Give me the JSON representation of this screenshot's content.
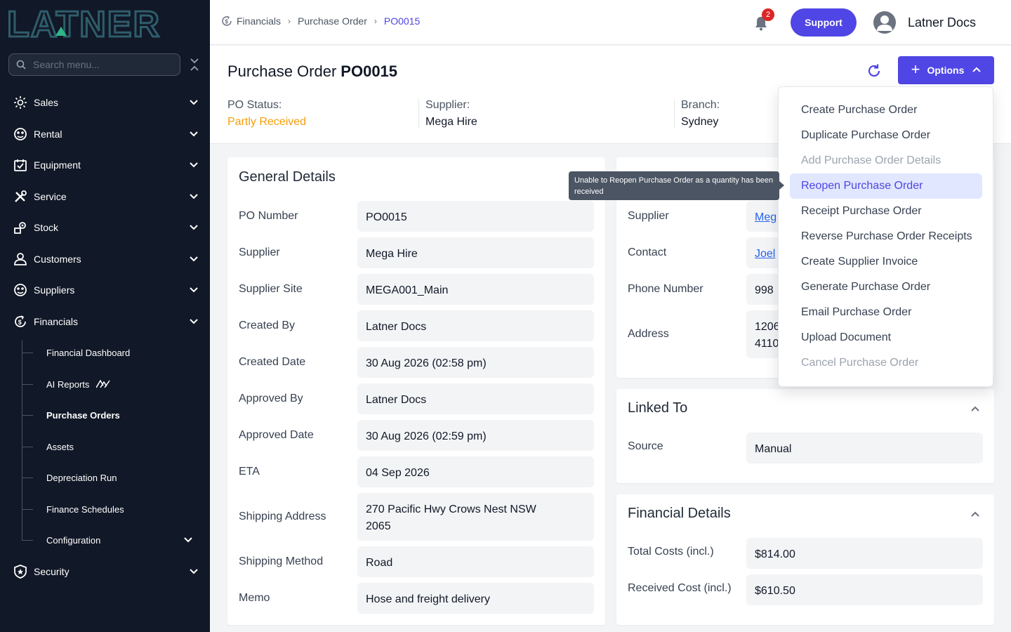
{
  "brand": {
    "logo_text": "LATNER",
    "accent": "#4f46e5",
    "sidebar_bg": "#111827"
  },
  "sidebar": {
    "search_placeholder": "Search menu...",
    "items": [
      {
        "label": "Sales",
        "icon": "sales-icon"
      },
      {
        "label": "Rental",
        "icon": "rental-icon"
      },
      {
        "label": "Equipment",
        "icon": "equipment-icon"
      },
      {
        "label": "Service",
        "icon": "service-icon"
      },
      {
        "label": "Stock",
        "icon": "stock-icon"
      },
      {
        "label": "Customers",
        "icon": "customers-icon"
      },
      {
        "label": "Suppliers",
        "icon": "suppliers-icon"
      },
      {
        "label": "Financials",
        "icon": "financials-icon"
      },
      {
        "label": "Security",
        "icon": "security-icon"
      }
    ],
    "sub_items": [
      {
        "label": "Financial Dashboard"
      },
      {
        "label": "AI Reports"
      },
      {
        "label": "Purchase Orders"
      },
      {
        "label": "Assets"
      },
      {
        "label": "Depreciation Run"
      },
      {
        "label": "Finance Schedules"
      },
      {
        "label": "Configuration"
      }
    ]
  },
  "topbar": {
    "breadcrumb": [
      "Financials",
      "Purchase Order",
      "PO0015"
    ],
    "notification_count": "2",
    "support_label": "Support",
    "user_name": "Latner Docs"
  },
  "header": {
    "title_prefix": "Purchase Order",
    "po_number": "PO0015",
    "options_label": "Options",
    "status_label": "PO Status:",
    "status_value": "Partly Received",
    "status_color": "#f59e0b",
    "supplier_label": "Supplier:",
    "supplier_value": "Mega Hire",
    "branch_label": "Branch:",
    "branch_value": "Sydney"
  },
  "general": {
    "title": "General Details",
    "rows": [
      {
        "label": "PO Number",
        "value": "PO0015"
      },
      {
        "label": "Supplier",
        "value": "Mega Hire"
      },
      {
        "label": "Supplier Site",
        "value": "MEGA001_Main"
      },
      {
        "label": "Created By",
        "value": "Latner Docs"
      },
      {
        "label": "Created Date",
        "value": "30 Aug 2026 (02:58 pm)"
      },
      {
        "label": "Approved By",
        "value": "Latner Docs"
      },
      {
        "label": "Approved Date",
        "value": "30 Aug 2026 (02:59 pm)"
      },
      {
        "label": "ETA",
        "value": "04 Sep 2026"
      },
      {
        "label": "Shipping Address",
        "value": "270 Pacific Hwy Crows Nest NSW 2065"
      },
      {
        "label": "Shipping Method",
        "value": "Road"
      },
      {
        "label": "Memo",
        "value": "Hose and freight delivery"
      }
    ]
  },
  "supplier_details": {
    "rows": [
      {
        "label": "Supplier",
        "value": "Meg"
      },
      {
        "label": "Contact",
        "value": "Joel"
      },
      {
        "label": "Phone Number",
        "value": "998"
      },
      {
        "label": "Address",
        "value": "1206 4110"
      }
    ]
  },
  "linked_to": {
    "title": "Linked To",
    "source_label": "Source",
    "source_value": "Manual"
  },
  "financial": {
    "title": "Financial Details",
    "rows": [
      {
        "label": "Total Costs (incl.)",
        "value": "$814.00"
      },
      {
        "label": "Received Cost (incl.)",
        "value": "$610.50"
      }
    ]
  },
  "options_menu": {
    "items": [
      {
        "label": "Create Purchase Order",
        "state": "enabled"
      },
      {
        "label": "Duplicate Purchase Order",
        "state": "enabled"
      },
      {
        "label": "Add Purchase Order Details",
        "state": "disabled"
      },
      {
        "label": "Reopen Purchase Order",
        "state": "hover"
      },
      {
        "label": "Receipt Purchase Order",
        "state": "enabled"
      },
      {
        "label": "Reverse Purchase Order Receipts",
        "state": "enabled"
      },
      {
        "label": "Create Supplier Invoice",
        "state": "enabled"
      },
      {
        "label": "Generate Purchase Order",
        "state": "enabled"
      },
      {
        "label": "Email Purchase Order",
        "state": "enabled"
      },
      {
        "label": "Upload Document",
        "state": "enabled"
      },
      {
        "label": "Cancel Purchase Order",
        "state": "disabled"
      }
    ]
  },
  "tooltip": {
    "text": "Unable to Reopen Purchase Order as a quantity has been received"
  }
}
